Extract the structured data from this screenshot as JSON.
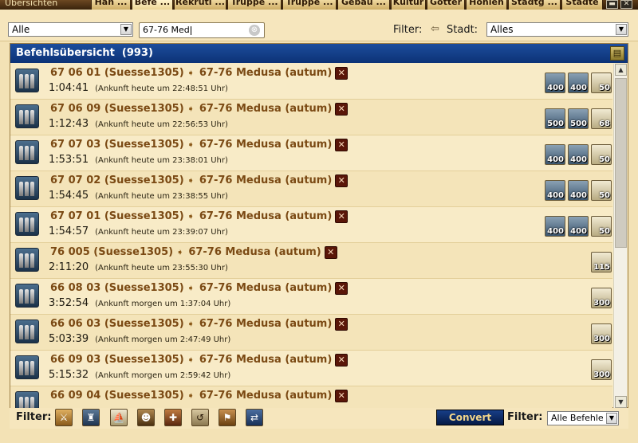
{
  "tabbar": {
    "title": "Übersichten",
    "tabs": [
      {
        "label": "Han ...",
        "active": false
      },
      {
        "label": "Befe ...",
        "active": true
      },
      {
        "label": "Rekruti ...",
        "active": false
      },
      {
        "label": "Truppe ...",
        "active": false
      },
      {
        "label": "Truppe ...",
        "active": false
      },
      {
        "label": "Gebäu ...",
        "active": false
      },
      {
        "label": "Kultur",
        "active": false
      },
      {
        "label": "Götter",
        "active": false
      },
      {
        "label": "Höhlen",
        "active": false
      },
      {
        "label": "Stadtg ...",
        "active": false
      },
      {
        "label": "Städte",
        "active": false
      }
    ],
    "minimize_label": "▬",
    "close_label": "✕"
  },
  "toolbar": {
    "type_select": "Alle",
    "search_value": "67-76 Med",
    "search_clear_icon": "⊗",
    "filter_label": "Filter:",
    "stadt_label": "Stadt:",
    "stadt_select": "Alles"
  },
  "panel": {
    "title": "Befehlsübersicht",
    "count": "(993)"
  },
  "commands": [
    {
      "origin": "67 06 01",
      "player": "(Suesse1305)",
      "target": "67-76 Medusa",
      "target_player": "(autum)",
      "time": "1:04:41",
      "arrival": "(Ankunft heute um 22:48:51 Uhr)",
      "units": [
        {
          "type": "soldier",
          "count": "400"
        },
        {
          "type": "soldier",
          "count": "400"
        },
        {
          "type": "ship",
          "count": "50"
        }
      ]
    },
    {
      "origin": "67 06 09",
      "player": "(Suesse1305)",
      "target": "67-76 Medusa",
      "target_player": "(autum)",
      "time": "1:12:43",
      "arrival": "(Ankunft heute um 22:56:53 Uhr)",
      "units": [
        {
          "type": "soldier",
          "count": "500"
        },
        {
          "type": "soldier",
          "count": "500"
        },
        {
          "type": "ship",
          "count": "68"
        }
      ]
    },
    {
      "origin": "67 07 03",
      "player": "(Suesse1305)",
      "target": "67-76 Medusa",
      "target_player": "(autum)",
      "time": "1:53:51",
      "arrival": "(Ankunft heute um 23:38:01 Uhr)",
      "units": [
        {
          "type": "soldier",
          "count": "400"
        },
        {
          "type": "soldier",
          "count": "400"
        },
        {
          "type": "ship",
          "count": "50"
        }
      ]
    },
    {
      "origin": "67 07 02",
      "player": "(Suesse1305)",
      "target": "67-76 Medusa",
      "target_player": "(autum)",
      "time": "1:54:45",
      "arrival": "(Ankunft heute um 23:38:55 Uhr)",
      "units": [
        {
          "type": "soldier",
          "count": "400"
        },
        {
          "type": "soldier",
          "count": "400"
        },
        {
          "type": "ship",
          "count": "50"
        }
      ]
    },
    {
      "origin": "67 07 01",
      "player": "(Suesse1305)",
      "target": "67-76 Medusa",
      "target_player": "(autum)",
      "time": "1:54:57",
      "arrival": "(Ankunft heute um 23:39:07 Uhr)",
      "units": [
        {
          "type": "soldier",
          "count": "400"
        },
        {
          "type": "soldier",
          "count": "400"
        },
        {
          "type": "ship",
          "count": "50"
        }
      ]
    },
    {
      "origin": "76 005",
      "player": "(Suesse1305)",
      "target": "67-76 Medusa",
      "target_player": "(autum)",
      "time": "2:11:20",
      "arrival": "(Ankunft heute um 23:55:30 Uhr)",
      "units": [
        {
          "type": "ship",
          "count": "115"
        }
      ]
    },
    {
      "origin": "66 08 03",
      "player": "(Suesse1305)",
      "target": "67-76 Medusa",
      "target_player": "(autum)",
      "time": "3:52:54",
      "arrival": "(Ankunft morgen um 1:37:04 Uhr)",
      "units": [
        {
          "type": "ship",
          "count": "300"
        }
      ]
    },
    {
      "origin": "66 06 03",
      "player": "(Suesse1305)",
      "target": "67-76 Medusa",
      "target_player": "(autum)",
      "time": "5:03:39",
      "arrival": "(Ankunft morgen um 2:47:49 Uhr)",
      "units": [
        {
          "type": "ship",
          "count": "300"
        }
      ]
    },
    {
      "origin": "66 09 03",
      "player": "(Suesse1305)",
      "target": "67-76 Medusa",
      "target_player": "(autum)",
      "time": "5:15:32",
      "arrival": "(Ankunft morgen um 2:59:42 Uhr)",
      "units": [
        {
          "type": "ship",
          "count": "300"
        }
      ]
    },
    {
      "origin": "66 09 04",
      "player": "(Suesse1305)",
      "target": "67-76 Medusa",
      "target_player": "(autum)",
      "time": "",
      "arrival": "",
      "units": []
    }
  ],
  "bottom": {
    "filter_label": "Filter:",
    "filter_icons": [
      "attack-icon",
      "troops-icon",
      "ship-icon",
      "spy-icon",
      "support-icon",
      "return-icon",
      "conquer-icon",
      "trade-icon"
    ],
    "convert_label": "Convert",
    "filter2_label": "Filter:",
    "filter_select": "Alle Befehle"
  },
  "colors": {
    "header_blue": "#0c3276",
    "link_brown": "#7b4a14",
    "cancel_red": "#5a1608",
    "parchment": "#f3e2b5"
  }
}
